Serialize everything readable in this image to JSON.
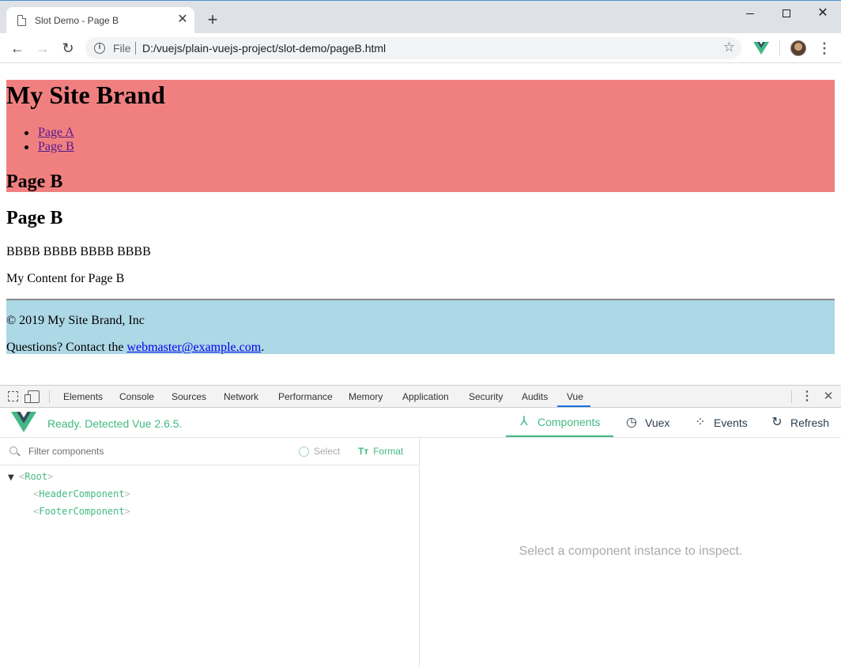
{
  "browser": {
    "tab_title": "Slot Demo - Page B",
    "new_tab_icon": "plus-icon",
    "url_scheme": "File",
    "url": "D:/vuejs/plain-vuejs-project/slot-demo/pageB.html"
  },
  "page": {
    "header": {
      "brand": "My Site Brand",
      "nav": [
        "Page A",
        "Page B"
      ],
      "title": "Page B"
    },
    "main": {
      "title": "Page B",
      "text": "BBBB BBBB BBBB BBBB",
      "content": "My Content for Page B"
    },
    "footer": {
      "copyright": "© 2019 My Site Brand, Inc",
      "contact_prefix": "Questions? Contact the ",
      "contact_link": "webmaster@example.com",
      "contact_suffix": "."
    },
    "colors": {
      "header_bg": "#f08080",
      "footer_bg": "#add8e6",
      "link": "#551a8b"
    }
  },
  "devtools": {
    "tabs": [
      "Elements",
      "Console",
      "Sources",
      "Network",
      "Performance",
      "Memory",
      "Application",
      "Security",
      "Audits",
      "Vue"
    ],
    "active_tab": "Vue",
    "vue": {
      "status": "Ready. Detected Vue 2.6.5.",
      "tabs": {
        "components": "Components",
        "vuex": "Vuex",
        "events": "Events",
        "refresh": "Refresh"
      },
      "filter_placeholder": "Filter components",
      "select_label": "Select",
      "format_label": "Format",
      "tree": [
        {
          "name": "Root",
          "expanded": true,
          "depth": 0
        },
        {
          "name": "HeaderComponent",
          "depth": 1
        },
        {
          "name": "FooterComponent",
          "depth": 1
        }
      ],
      "inspect_message": "Select a component instance to inspect.",
      "accent": "#42b983"
    }
  }
}
